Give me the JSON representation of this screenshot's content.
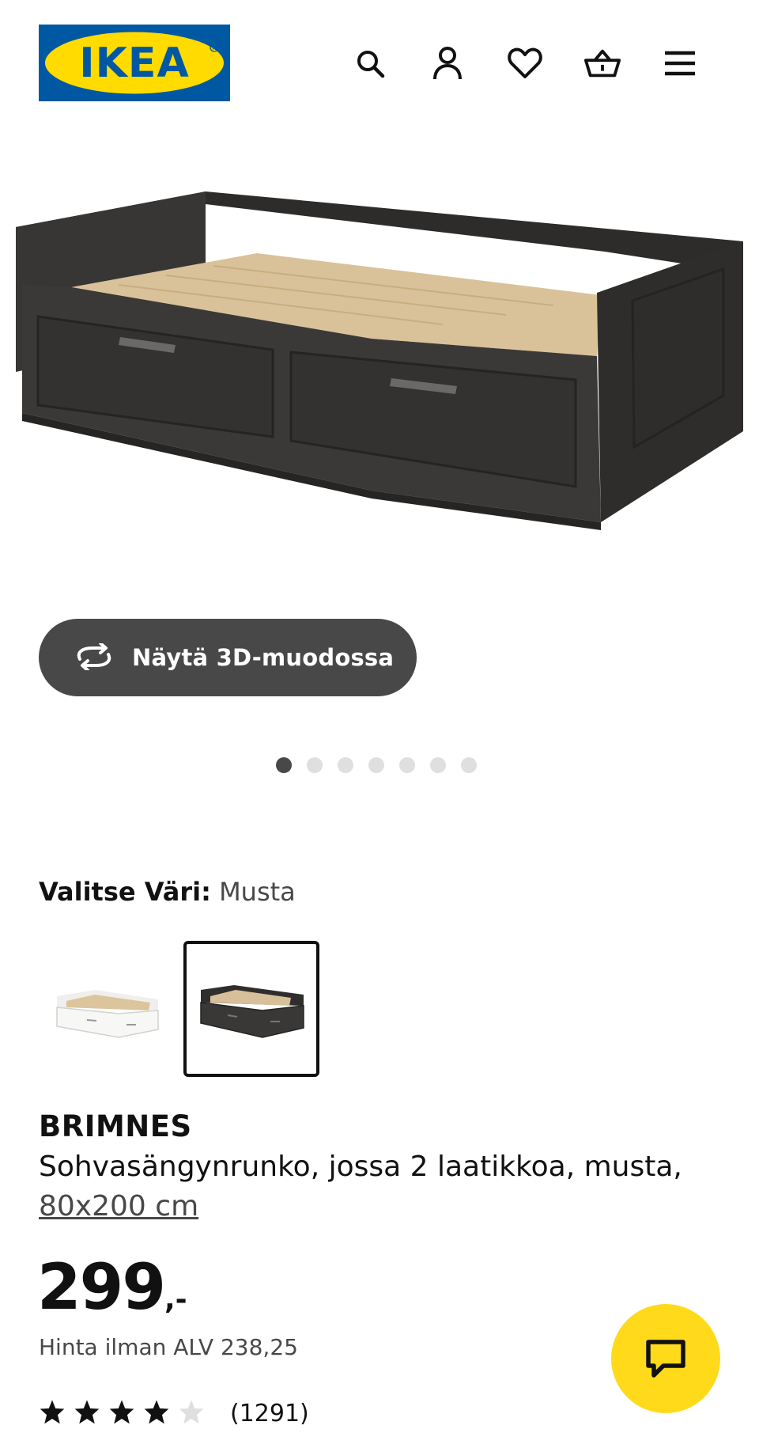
{
  "header": {
    "logo_text": "IKEA",
    "icons": [
      "search-icon",
      "account-icon",
      "heart-icon",
      "cart-icon",
      "menu-icon"
    ],
    "colors": {
      "logo_blue": "#0058a3",
      "logo_yellow": "#ffdb00"
    }
  },
  "viewer": {
    "button_label": "Näytä 3D-muodossa",
    "dots_total": 7,
    "active_dot": 1
  },
  "color_select": {
    "label": "Valitse Väri:",
    "value": "Musta",
    "swatches": [
      {
        "name": "white",
        "selected": false
      },
      {
        "name": "black",
        "selected": true
      }
    ]
  },
  "product": {
    "name": "BRIMNES",
    "description": "Sohvasängynrunko, jossa 2 laatikkoa, musta,",
    "size": "80x200 cm",
    "price": "299",
    "price_suffix": ",-",
    "vat_text": "Hinta ilman ALV 238,25",
    "rating": 4,
    "rating_max": 5,
    "review_count": "(1291)"
  },
  "colors": {
    "dark_button": "#484848",
    "chat_yellow": "#ffda1a",
    "text": "#111111"
  }
}
